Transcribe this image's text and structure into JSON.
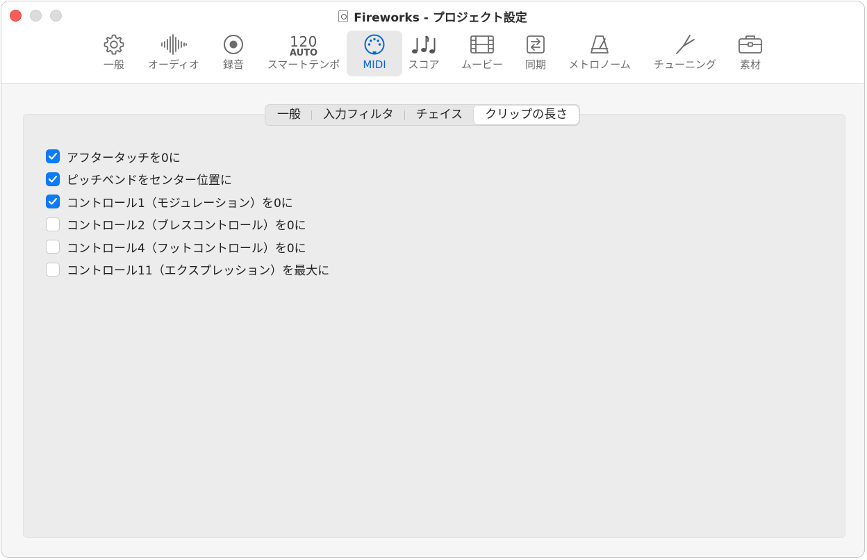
{
  "window": {
    "title": "Fireworks - プロジェクト設定"
  },
  "toolbar": {
    "items": [
      {
        "label": "一般",
        "icon": "gear-icon"
      },
      {
        "label": "オーディオ",
        "icon": "waveform-icon"
      },
      {
        "label": "録音",
        "icon": "record-icon"
      },
      {
        "label": "スマートテンポ",
        "icon": "tempo-icon",
        "tempo_number": "120",
        "tempo_mode": "AUTO"
      },
      {
        "label": "MIDI",
        "icon": "midi-connector-icon",
        "active": true
      },
      {
        "label": "スコア",
        "icon": "music-notes-icon"
      },
      {
        "label": "ムービー",
        "icon": "film-icon"
      },
      {
        "label": "同期",
        "icon": "sync-icon"
      },
      {
        "label": "メトロノーム",
        "icon": "metronome-icon"
      },
      {
        "label": "チューニング",
        "icon": "tuning-fork-icon"
      },
      {
        "label": "素材",
        "icon": "briefcase-icon"
      }
    ]
  },
  "tabs": [
    {
      "label": "一般"
    },
    {
      "label": "入力フィルタ"
    },
    {
      "label": "チェイス"
    },
    {
      "label": "クリップの長さ",
      "selected": true
    }
  ],
  "options": [
    {
      "label": "アフタータッチを0に",
      "checked": true
    },
    {
      "label": "ピッチベンドをセンター位置に",
      "checked": true
    },
    {
      "label": "コントロール1（モジュレーション）を0に",
      "checked": true
    },
    {
      "label": "コントロール2（ブレスコントロール）を0に",
      "checked": false
    },
    {
      "label": "コントロール4（フットコントロール）を0に",
      "checked": false
    },
    {
      "label": "コントロール11（エクスプレッション）を最大に",
      "checked": false
    }
  ],
  "colors": {
    "accent": "#0a63d8",
    "checkbox_checked": "#0a7bff",
    "close_button": "#ff5f57"
  }
}
